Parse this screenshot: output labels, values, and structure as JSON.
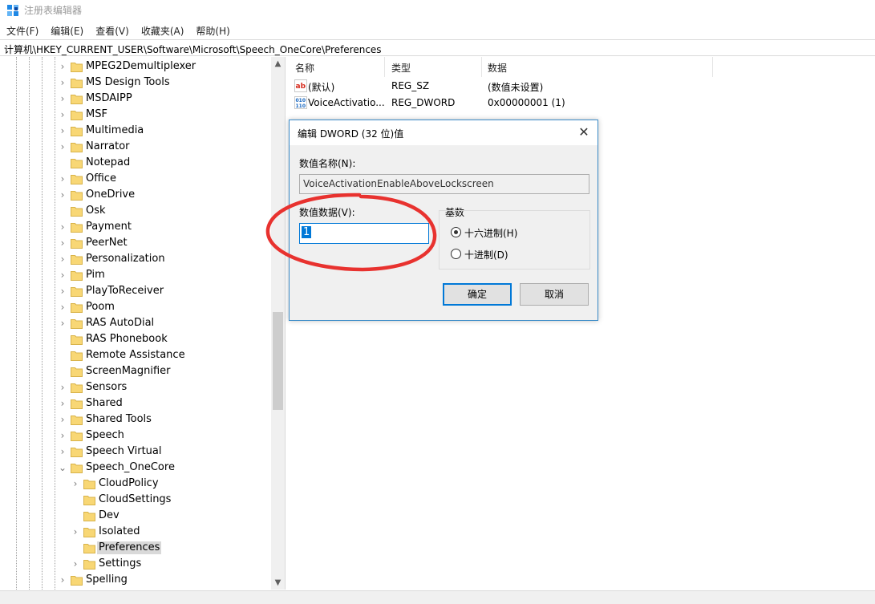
{
  "window": {
    "title": "注册表编辑器"
  },
  "menu": [
    "文件(F)",
    "编辑(E)",
    "查看(V)",
    "收藏夹(A)",
    "帮助(H)"
  ],
  "address": "计算机\\HKEY_CURRENT_USER\\Software\\Microsoft\\Speech_OneCore\\Preferences",
  "tree": {
    "items": [
      {
        "label": "MPEG2Demultiplexer",
        "level": 0,
        "expander": "collapsed",
        "selected": false
      },
      {
        "label": "MS Design Tools",
        "level": 0,
        "expander": "collapsed",
        "selected": false
      },
      {
        "label": "MSDAIPP",
        "level": 0,
        "expander": "collapsed",
        "selected": false
      },
      {
        "label": "MSF",
        "level": 0,
        "expander": "collapsed",
        "selected": false
      },
      {
        "label": "Multimedia",
        "level": 0,
        "expander": "collapsed",
        "selected": false
      },
      {
        "label": "Narrator",
        "level": 0,
        "expander": "collapsed",
        "selected": false
      },
      {
        "label": "Notepad",
        "level": 0,
        "expander": "none",
        "selected": false
      },
      {
        "label": "Office",
        "level": 0,
        "expander": "collapsed",
        "selected": false
      },
      {
        "label": "OneDrive",
        "level": 0,
        "expander": "collapsed",
        "selected": false
      },
      {
        "label": "Osk",
        "level": 0,
        "expander": "none",
        "selected": false
      },
      {
        "label": "Payment",
        "level": 0,
        "expander": "collapsed",
        "selected": false
      },
      {
        "label": "PeerNet",
        "level": 0,
        "expander": "collapsed",
        "selected": false
      },
      {
        "label": "Personalization",
        "level": 0,
        "expander": "collapsed",
        "selected": false
      },
      {
        "label": "Pim",
        "level": 0,
        "expander": "collapsed",
        "selected": false
      },
      {
        "label": "PlayToReceiver",
        "level": 0,
        "expander": "collapsed",
        "selected": false
      },
      {
        "label": "Poom",
        "level": 0,
        "expander": "collapsed",
        "selected": false
      },
      {
        "label": "RAS AutoDial",
        "level": 0,
        "expander": "collapsed",
        "selected": false
      },
      {
        "label": "RAS Phonebook",
        "level": 0,
        "expander": "none",
        "selected": false
      },
      {
        "label": "Remote Assistance",
        "level": 0,
        "expander": "none",
        "selected": false
      },
      {
        "label": "ScreenMagnifier",
        "level": 0,
        "expander": "none",
        "selected": false
      },
      {
        "label": "Sensors",
        "level": 0,
        "expander": "collapsed",
        "selected": false
      },
      {
        "label": "Shared",
        "level": 0,
        "expander": "collapsed",
        "selected": false
      },
      {
        "label": "Shared Tools",
        "level": 0,
        "expander": "collapsed",
        "selected": false
      },
      {
        "label": "Speech",
        "level": 0,
        "expander": "collapsed",
        "selected": false
      },
      {
        "label": "Speech Virtual",
        "level": 0,
        "expander": "collapsed",
        "selected": false
      },
      {
        "label": "Speech_OneCore",
        "level": 0,
        "expander": "expanded",
        "selected": false
      },
      {
        "label": "CloudPolicy",
        "level": 1,
        "expander": "collapsed",
        "selected": false
      },
      {
        "label": "CloudSettings",
        "level": 1,
        "expander": "none",
        "selected": false
      },
      {
        "label": "Dev",
        "level": 1,
        "expander": "none",
        "selected": false
      },
      {
        "label": "Isolated",
        "level": 1,
        "expander": "collapsed",
        "selected": false
      },
      {
        "label": "Preferences",
        "level": 1,
        "expander": "none",
        "selected": true
      },
      {
        "label": "Settings",
        "level": 1,
        "expander": "collapsed",
        "selected": false
      },
      {
        "label": "Spelling",
        "level": 0,
        "expander": "collapsed",
        "selected": false
      }
    ]
  },
  "list": {
    "headers": [
      "名称",
      "类型",
      "数据"
    ],
    "rows": [
      {
        "icon": "string-value-icon",
        "name": "(默认)",
        "type": "REG_SZ",
        "data": "(数值未设置)"
      },
      {
        "icon": "binary-value-icon",
        "name": "VoiceActivatio...",
        "type": "REG_DWORD",
        "data": "0x00000001 (1)"
      }
    ]
  },
  "dialog": {
    "title": "编辑 DWORD (32 位)值",
    "name_label": "数值名称(N):",
    "name_value": "VoiceActivationEnableAboveLockscreen",
    "data_label": "数值数据(V):",
    "data_value": "1",
    "base_label": "基数",
    "radio_hex": "十六进制(H)",
    "radio_dec": "十进制(D)",
    "selected_base": "hex",
    "ok": "确定",
    "cancel": "取消"
  },
  "colors": {
    "accent": "#0078d7",
    "folder": "#f8d775",
    "annotation": "#e8322f"
  }
}
